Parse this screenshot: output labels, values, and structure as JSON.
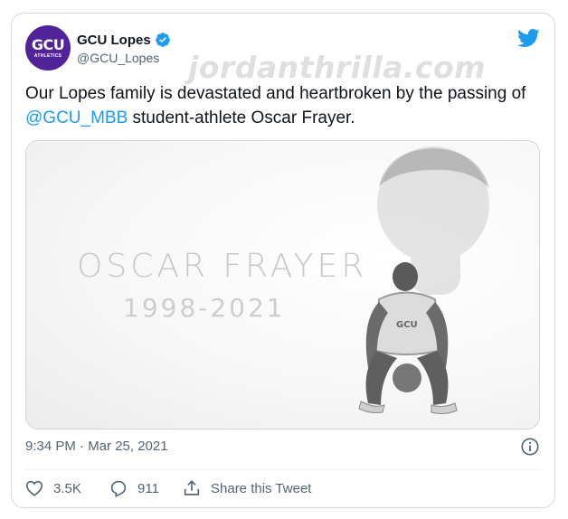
{
  "account": {
    "display_name": "GCU Lopes",
    "handle": "@GCU_Lopes",
    "avatar_text": "GCU",
    "avatar_subtext": "ATHLETICS"
  },
  "watermark": "jordanthrilla.com",
  "tweet": {
    "text_before": "Our Lopes family is devastated and heartbroken by the passing of ",
    "mention": "@GCU_MBB",
    "text_after": " student-athlete Oscar Frayer."
  },
  "media": {
    "name": "OSCAR FRAYER",
    "years": "1998-2021",
    "jersey_text": "GCU"
  },
  "timestamp": "9:34 PM · Mar 25, 2021",
  "actions": {
    "likes": "3.5K",
    "replies": "911",
    "share_label": "Share this Tweet"
  },
  "colors": {
    "brand_purple": "#522398",
    "twitter_blue": "#1d9bf0",
    "muted_text": "#536471"
  },
  "icons": [
    "verified-icon",
    "twitter-bird-icon",
    "info-icon",
    "heart-icon",
    "reply-icon",
    "share-icon"
  ]
}
